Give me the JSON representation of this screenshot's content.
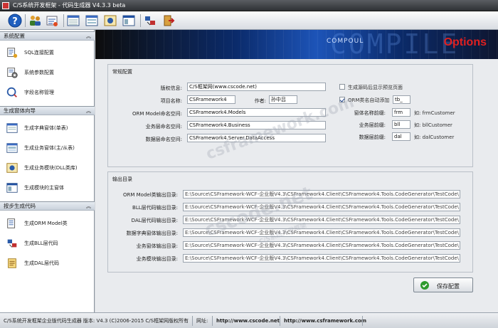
{
  "window": {
    "title": "C/S系统开发框架 - 代码生成器 V4.3.3 beta"
  },
  "toolbar": {
    "icons": [
      "help-icon",
      "users-icon",
      "tools-icon",
      "list-icon",
      "form-icon",
      "module-icon",
      "window-icon",
      "export-icon",
      "exit-icon"
    ]
  },
  "sidebar": {
    "groups": [
      {
        "label": "系统配置",
        "items": [
          {
            "label": "SQL连接配置"
          },
          {
            "label": "系统参数配置"
          },
          {
            "label": "字段名称管理"
          }
        ]
      },
      {
        "label": "生成窗体向导",
        "items": [
          {
            "label": "生成字典窗体(单表)"
          },
          {
            "label": "生成业务窗体(主/从表)"
          },
          {
            "label": "生成业务模块(DLL类库)"
          },
          {
            "label": "生成模块的主窗体"
          }
        ]
      },
      {
        "label": "按步生成代码",
        "items": [
          {
            "label": "生成ORM Model类"
          },
          {
            "label": "生成BLL层代码"
          },
          {
            "label": "生成DAL层代码"
          }
        ]
      }
    ]
  },
  "banner": {
    "bg_text": "COMPILE",
    "small_text": "COMPOUL",
    "options": "Options",
    "accent": "#e02020"
  },
  "general": {
    "legend": "常规配置",
    "copyright_label": "版权信息:",
    "copyright_value": "C/S框架网(www.cscode.net)",
    "project_label": "项目名称:",
    "project_value": "CSFramework4",
    "author_label": "作者:",
    "author_value": "孙中吕",
    "orm_ns_label": "ORM Model命名空间:",
    "orm_ns_value": "CSFramework4.Models",
    "bll_ns_label": "业务层命名空间:",
    "bll_ns_value": "CSFramework4.Business",
    "dal_ns_label": "数据层命名空间:",
    "dal_ns_value": "CSFramework4.Server.DataAccess",
    "preview_label": "生成源码后显示预览页面",
    "orm_prefix_label": "ORM类名自动添加",
    "orm_prefix_value": "tb_",
    "form_prefix_label": "窗体名称前缀:",
    "form_prefix_value": "frm",
    "form_example": "如: frmCustomer",
    "bll_prefix_label": "业务层前缀:",
    "bll_prefix_value": "bll",
    "bll_example": "如: bllCustomer",
    "dal_prefix_label": "数据层前缀:",
    "dal_prefix_value": "dal",
    "dal_example": "如: dalCustomer"
  },
  "output": {
    "legend": "输出目录",
    "rows": [
      {
        "label": "ORM Model类输出目录:",
        "value": "E:\\Source\\CSFramework-WCF-企业版V4.3\\CSFramework4.Client\\CSFramework4.Tools.CodeGenerator\\TestCode\\"
      },
      {
        "label": "BLL层代码输出目录:",
        "value": "E:\\Source\\CSFramework-WCF-企业版V4.3\\CSFramework4.Client\\CSFramework4.Tools.CodeGenerator\\TestCode\\"
      },
      {
        "label": "DAL层代码输出目录:",
        "value": "E:\\Source\\CSFramework-WCF-企业版V4.3\\CSFramework4.Client\\CSFramework4.Tools.CodeGenerator\\TestCode\\"
      },
      {
        "label": "数据字典窗体输出目录:",
        "value": "E:\\Source\\CSFramework-WCF-企业版V4.3\\CSFramework4.Client\\CSFramework4.Tools.CodeGenerator\\TestCode\\"
      },
      {
        "label": "业务窗体输出目录:",
        "value": "E:\\Source\\CSFramework-WCF-企业版V4.3\\CSFramework4.Client\\CSFramework4.Tools.CodeGenerator\\TestCode\\"
      },
      {
        "label": "业务模块输出目录:",
        "value": "E:\\Source\\CSFramework-WCF-企业版V4.3\\CSFramework4.Client\\CSFramework4.Tools.CodeGenerator\\TestCode\\"
      }
    ],
    "save_label": "保存配置"
  },
  "status": {
    "copyright": "C/S系统开发框架企业版代码生成器 版本: V4.3 (C)2006-2015 C/S框架网版权所有",
    "site_label": "网址:",
    "site1": "http://www.cscode.net",
    "site2": "http://www.csframework.com"
  },
  "watermark": {
    "line1": "cscode.net",
    "line2": "C/S系统开发框架",
    "line3": "csframework.com"
  }
}
